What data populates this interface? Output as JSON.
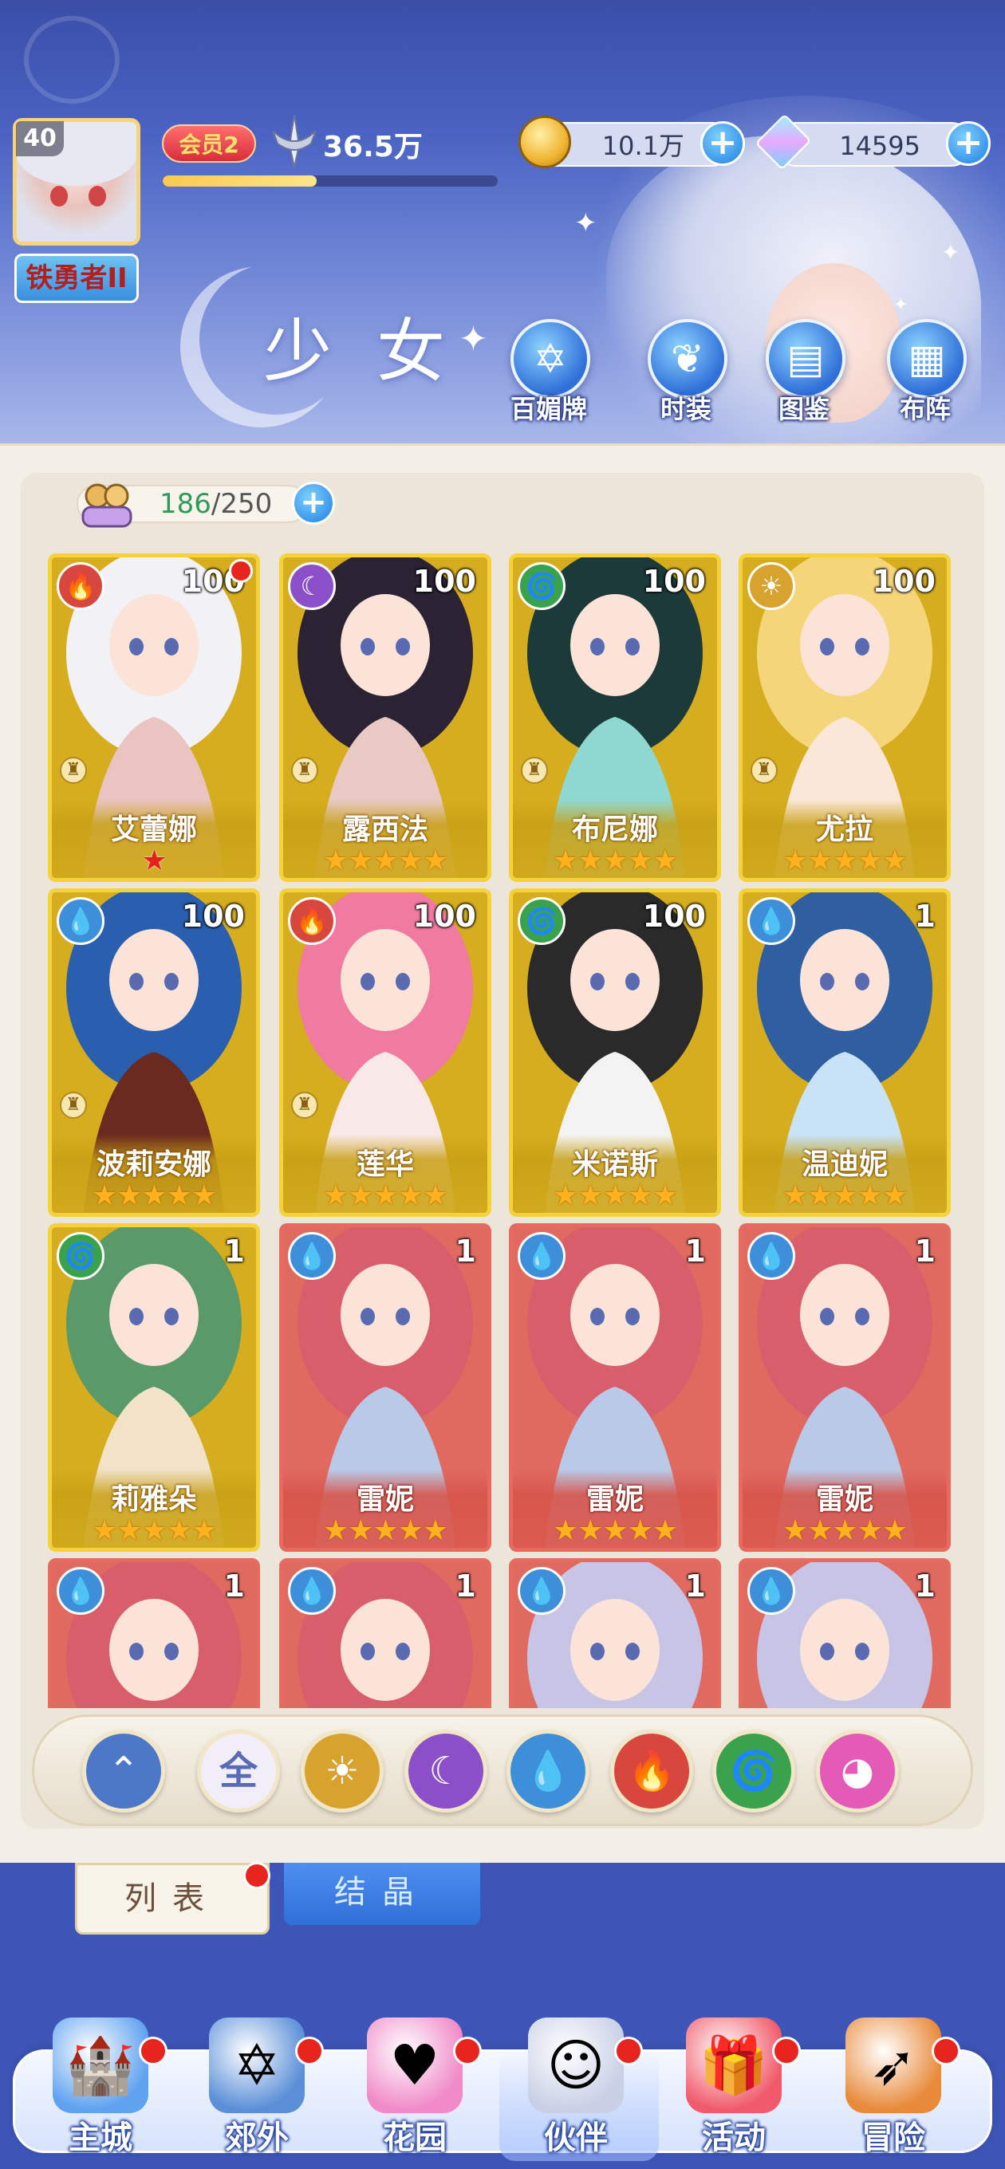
{
  "player": {
    "level": "40",
    "title": "铁勇者II",
    "vip": "会员2",
    "power": "36.5万",
    "exp_progress": 0.46
  },
  "resources": {
    "gold": "10.1万",
    "gems": "14595"
  },
  "page_title": "少女",
  "functions": [
    {
      "label": "百媚牌",
      "icon": "card-deck-icon"
    },
    {
      "label": "时装",
      "icon": "outfit-icon"
    },
    {
      "label": "图鉴",
      "icon": "book-icon"
    },
    {
      "label": "布阵",
      "icon": "grid-formation-icon"
    }
  ],
  "capacity": {
    "current": "186",
    "sep": "/",
    "max": "250"
  },
  "colors": {
    "fire": "#d8473d",
    "dark": "#8b4fc9",
    "wind": "#3aa14d",
    "light": "#d7a22d",
    "water": "#3d8fd9",
    "all": "#6a7fd0",
    "love": "#e35bb6"
  },
  "cards": [
    {
      "name": "艾蕾娜",
      "level": "100",
      "element": "fire",
      "glyph": "🔥",
      "rarity": "gold",
      "stars": "★",
      "stars_red": true,
      "pawn": true,
      "dot": true
    },
    {
      "name": "露西法",
      "level": "100",
      "element": "dark",
      "glyph": "☾",
      "rarity": "gold",
      "stars": "★★★★★",
      "pawn": true
    },
    {
      "name": "布尼娜",
      "level": "100",
      "element": "wind",
      "glyph": "🌀",
      "rarity": "gold",
      "stars": "★★★★★",
      "pawn": true
    },
    {
      "name": "尤拉",
      "level": "100",
      "element": "light",
      "glyph": "☀",
      "rarity": "gold",
      "stars": "★★★★★",
      "pawn": true
    },
    {
      "name": "波莉安娜",
      "level": "100",
      "element": "water",
      "glyph": "💧",
      "rarity": "gold",
      "stars": "★★★★★",
      "pawn": true
    },
    {
      "name": "莲华",
      "level": "100",
      "element": "fire",
      "glyph": "🔥",
      "rarity": "gold",
      "stars": "★★★★★",
      "pawn": true
    },
    {
      "name": "米诺斯",
      "level": "100",
      "element": "wind",
      "glyph": "🌀",
      "rarity": "gold",
      "stars": "★★★★★"
    },
    {
      "name": "温迪妮",
      "level": "1",
      "element": "water",
      "glyph": "💧",
      "rarity": "gold",
      "stars": "★★★★★"
    },
    {
      "name": "莉雅朵",
      "level": "1",
      "element": "wind",
      "glyph": "🌀",
      "rarity": "gold",
      "stars": "★★★★★"
    },
    {
      "name": "雷妮",
      "level": "1",
      "element": "water",
      "glyph": "💧",
      "rarity": "red",
      "stars": "★★★★★"
    },
    {
      "name": "雷妮",
      "level": "1",
      "element": "water",
      "glyph": "💧",
      "rarity": "red",
      "stars": "★★★★★"
    },
    {
      "name": "雷妮",
      "level": "1",
      "element": "water",
      "glyph": "💧",
      "rarity": "red",
      "stars": "★★★★★"
    },
    {
      "name": "",
      "level": "1",
      "element": "water",
      "glyph": "💧",
      "rarity": "red",
      "stars": ""
    },
    {
      "name": "",
      "level": "1",
      "element": "water",
      "glyph": "💧",
      "rarity": "red",
      "stars": ""
    },
    {
      "name": "",
      "level": "1",
      "element": "water",
      "glyph": "💧",
      "rarity": "red",
      "stars": ""
    },
    {
      "name": "",
      "level": "1",
      "element": "water",
      "glyph": "💧",
      "rarity": "red",
      "stars": ""
    }
  ],
  "filters": [
    {
      "name": "filter-sort",
      "glyph": "⌃",
      "color": "#4d78c8"
    },
    {
      "name": "filter-all",
      "glyph": "全",
      "color": "#f1eef7",
      "text_color": "#5a6bb5"
    },
    {
      "name": "filter-light",
      "glyph": "☀",
      "color": "#d7a22d"
    },
    {
      "name": "filter-dark",
      "glyph": "☾",
      "color": "#8b4fc9"
    },
    {
      "name": "filter-water",
      "glyph": "💧",
      "color": "#3d8fd9"
    },
    {
      "name": "filter-fire",
      "glyph": "🔥",
      "color": "#d8473d"
    },
    {
      "name": "filter-wind",
      "glyph": "🌀",
      "color": "#3aa14d"
    },
    {
      "name": "filter-love",
      "glyph": "◕",
      "color": "#e35bb6"
    }
  ],
  "tabs": {
    "list": "列表",
    "crystal": "结晶"
  },
  "nav": [
    {
      "label": "主城",
      "icon": "castle-icon",
      "color": "#5fa2f0"
    },
    {
      "label": "郊外",
      "icon": "portal-icon",
      "color": "#5a8fd8"
    },
    {
      "label": "花园",
      "icon": "heart-garden-icon",
      "color": "#f08ac8"
    },
    {
      "label": "伙伴",
      "icon": "partner-icon",
      "color": "#c9d0e6"
    },
    {
      "label": "活动",
      "icon": "gift-icon",
      "color": "#f05a6a"
    },
    {
      "label": "冒险",
      "icon": "compass-icon",
      "color": "#e88a3a"
    }
  ]
}
